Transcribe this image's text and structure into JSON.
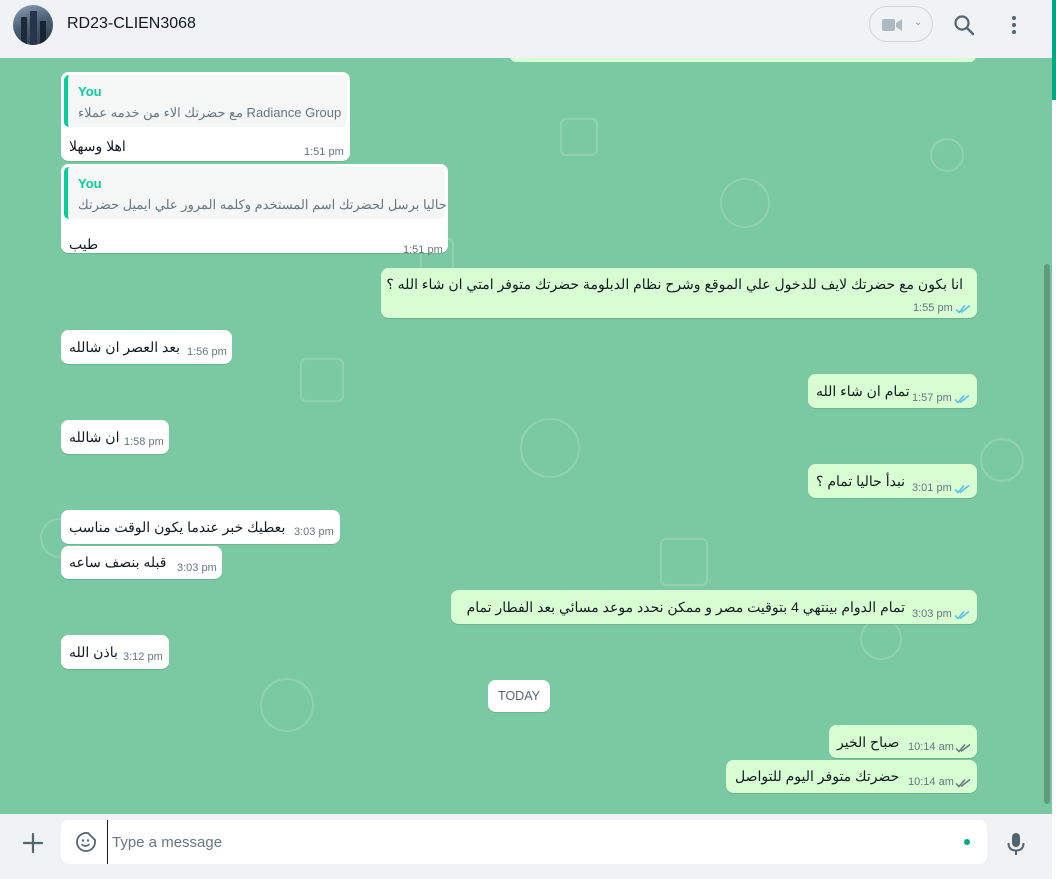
{
  "header": {
    "contact_name": "RD23-CLIEN3068",
    "video_call_icon": "video-camera-icon",
    "search_icon": "search-icon",
    "menu_icon": "kebab-menu-icon"
  },
  "messages": [
    {
      "dir": "in",
      "quote_author": "You",
      "quote_text": "مع حضرتك الاء من خدمه عملاء Radiance Group",
      "text": "اهلا وسهلا",
      "time": "1:51 pm"
    },
    {
      "dir": "in",
      "quote_author": "You",
      "quote_text": "حاليا برسل لحضرتك اسم المستخدم وكلمه المرور علي ايميل حضرتك",
      "text": "طيب",
      "time": "1:51 pm"
    },
    {
      "dir": "out",
      "text": "انا بكون مع حضرتك لايف للدخول علي الموقع وشرح نظام الدبلومة حضرتك متوفر امتي ان شاء الله ؟",
      "time": "1:55 pm"
    },
    {
      "dir": "in",
      "text": "بعد العصر ان شالله",
      "time": "1:56 pm"
    },
    {
      "dir": "out",
      "text": "تمام ان شاء الله",
      "time": "1:57 pm"
    },
    {
      "dir": "in",
      "text": "ان شالله",
      "time": "1:58 pm"
    },
    {
      "dir": "out",
      "text": "نبدأ حاليا تمام ؟",
      "time": "3:01 pm"
    },
    {
      "dir": "in",
      "text": "بعطيك خبر عندما يكون الوقت مناسب",
      "time": "3:03 pm"
    },
    {
      "dir": "in",
      "text": "قبله بنصف ساعه",
      "time": "3:03 pm"
    },
    {
      "dir": "out",
      "text": "تمام الدوام بينتهي 4 بتوقيت مصر و ممكن نحدد موعد مسائي بعد الفطار تمام",
      "time": "3:03 pm"
    },
    {
      "dir": "in",
      "text": "باذن الله",
      "time": "3:12 pm"
    },
    {
      "dir": "out",
      "text": "صباح الخير",
      "time": "10:14 am"
    },
    {
      "dir": "out",
      "text": "حضرتك متوفر اليوم للتواصل",
      "time": "10:14 am"
    }
  ],
  "date_divider": "TODAY",
  "composer": {
    "placeholder": "Type a message",
    "attach_icon": "plus-icon",
    "emoji_icon": "sticker-emoji-icon",
    "mic_icon": "microphone-icon"
  },
  "colors": {
    "chat_bg": "#7bc9a2",
    "outgoing_bubble": "#d9fdd3",
    "incoming_bubble": "#ffffff",
    "accent": "#00a884",
    "read_ticks": "#53bdeb"
  }
}
